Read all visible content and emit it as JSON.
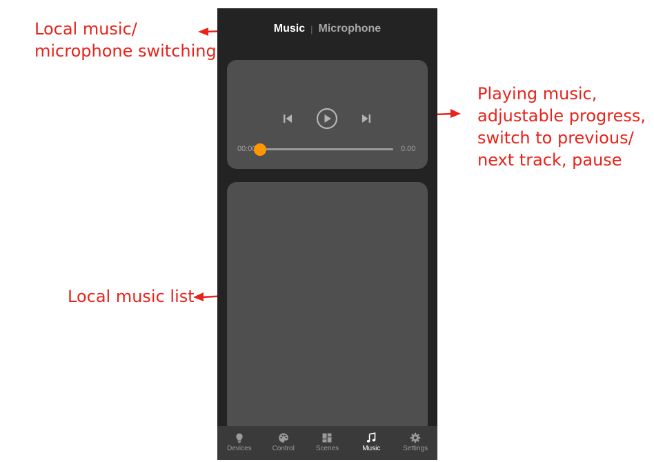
{
  "annotations": {
    "switching": "Local music/\nmicrophone switching",
    "playing": "Playing music,\nadjustable progress,\nswitch to previous/\nnext track, pause",
    "list": "Local music list"
  },
  "header": {
    "tab_music": "Music",
    "tab_microphone": "Microphone",
    "separator": "|"
  },
  "player": {
    "elapsed": "00:00",
    "duration": "0.00",
    "progress": 0.0,
    "icons": [
      "previous-track-icon",
      "play-icon",
      "next-track-icon"
    ]
  },
  "nav": {
    "items": [
      {
        "label": "Devices",
        "icon": "bulb-icon"
      },
      {
        "label": "Control",
        "icon": "palette-icon"
      },
      {
        "label": "Scenes",
        "icon": "scenes-grid-icon"
      },
      {
        "label": "Music",
        "icon": "music-note-icon"
      },
      {
        "label": "Settings",
        "icon": "gear-icon"
      }
    ],
    "active": "Music"
  },
  "colors": {
    "annotation": "#e8231b",
    "accent": "#ff9800",
    "panel": "#4f4f4f",
    "background": "#232323"
  }
}
